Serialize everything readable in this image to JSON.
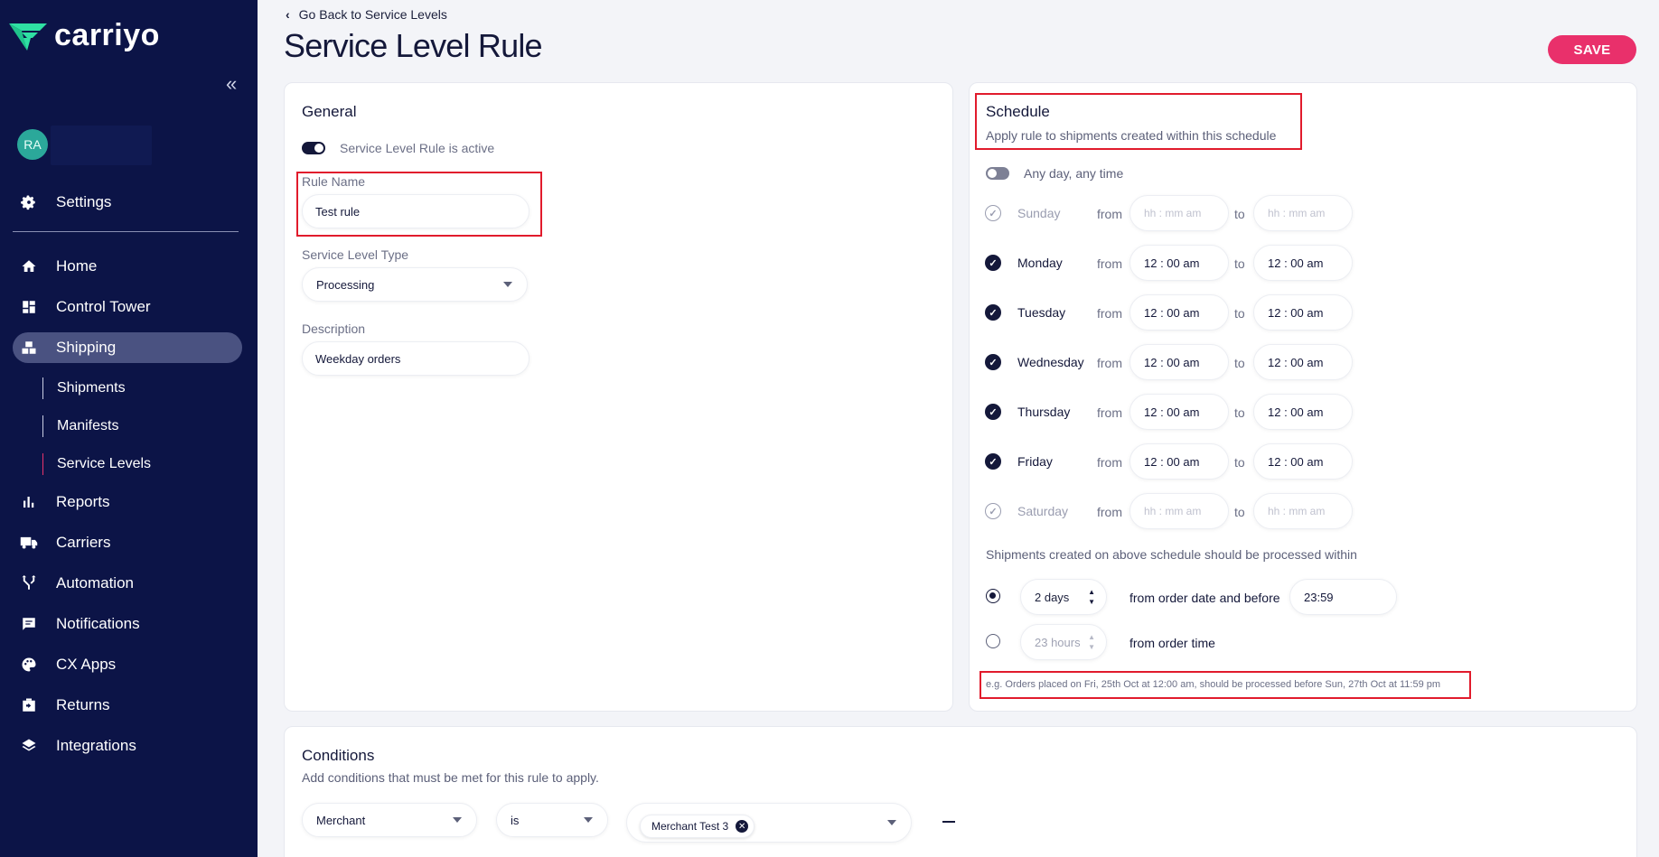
{
  "app": {
    "name": "carriyo",
    "user_initials": "RA"
  },
  "sidebar": {
    "settings": "Settings",
    "items": [
      {
        "label": "Home",
        "icon": "home-icon"
      },
      {
        "label": "Control Tower",
        "icon": "dashboard-icon"
      },
      {
        "label": "Shipping",
        "icon": "boxes-icon"
      },
      {
        "label": "Reports",
        "icon": "bar-chart-icon"
      },
      {
        "label": "Carriers",
        "icon": "truck-icon"
      },
      {
        "label": "Automation",
        "icon": "fork-icon"
      },
      {
        "label": "Notifications",
        "icon": "chat-icon"
      },
      {
        "label": "CX Apps",
        "icon": "palette-icon"
      },
      {
        "label": "Returns",
        "icon": "return-box-icon"
      },
      {
        "label": "Integrations",
        "icon": "layers-icon"
      }
    ],
    "shipping_sub": [
      "Shipments",
      "Manifests",
      "Service Levels"
    ]
  },
  "header": {
    "back_link": "Go Back to Service Levels",
    "title": "Service Level Rule",
    "save_label": "SAVE"
  },
  "general": {
    "heading": "General",
    "active_toggle_label": "Service Level Rule is active",
    "rule_name_label": "Rule Name",
    "rule_name_value": "Test rule",
    "type_label": "Service Level Type",
    "type_value": "Processing",
    "description_label": "Description",
    "description_value": "Weekday orders"
  },
  "schedule": {
    "heading": "Schedule",
    "subheading": "Apply rule to shipments created within this schedule",
    "any_time_label": "Any day, any time",
    "from_label": "from",
    "to_label": "to",
    "days": [
      {
        "name": "Sunday",
        "enabled": false,
        "from": "hh : mm am",
        "to": "hh : mm am"
      },
      {
        "name": "Monday",
        "enabled": true,
        "from": "12 : 00  am",
        "to": "12 : 00  am"
      },
      {
        "name": "Tuesday",
        "enabled": true,
        "from": "12 : 00  am",
        "to": "12 : 00  am"
      },
      {
        "name": "Wednesday",
        "enabled": true,
        "from": "12 : 00  am",
        "to": "12 : 00  am"
      },
      {
        "name": "Thursday",
        "enabled": true,
        "from": "12 : 00  am",
        "to": "12 : 00  am"
      },
      {
        "name": "Friday",
        "enabled": true,
        "from": "12 : 00  am",
        "to": "12 : 00  am"
      },
      {
        "name": "Saturday",
        "enabled": false,
        "from": "hh : mm am",
        "to": "hh : mm am"
      }
    ],
    "processing_label": "Shipments created on above schedule should be processed within",
    "option1_value": "2 days",
    "option1_text": "from order date and before",
    "option1_time": "23:59",
    "option2_value": "23 hours",
    "option2_text": "from order time",
    "example": "e.g. Orders placed on Fri, 25th Oct at 12:00 am, should be processed before Sun, 27th Oct at 11:59 pm"
  },
  "conditions": {
    "heading": "Conditions",
    "subheading": "Add conditions that must be met for this rule to apply.",
    "field_value": "Merchant",
    "operator_value": "is",
    "chip_value": "Merchant Test 3"
  },
  "colors": {
    "sidebar": "#0c1447",
    "accent": "#e9306b",
    "highlight_box": "#e11b2c"
  }
}
